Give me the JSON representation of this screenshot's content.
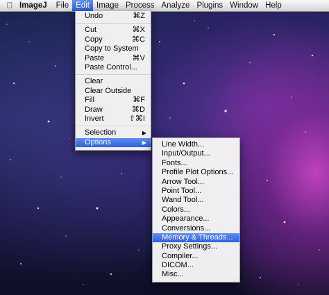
{
  "menubar": {
    "apple_icon": "apple-logo-icon",
    "items": [
      {
        "label": "ImageJ"
      },
      {
        "label": "File"
      },
      {
        "label": "Edit"
      },
      {
        "label": "Image"
      },
      {
        "label": "Process"
      },
      {
        "label": "Analyze"
      },
      {
        "label": "Plugins"
      },
      {
        "label": "Window"
      },
      {
        "label": "Help"
      }
    ],
    "active_menu": "Edit"
  },
  "edit_menu": {
    "undo": {
      "label": "Undo",
      "shortcut": "⌘Z"
    },
    "cut": {
      "label": "Cut",
      "shortcut": "⌘X"
    },
    "copy": {
      "label": "Copy",
      "shortcut": "⌘C"
    },
    "copy_to_system": {
      "label": "Copy to System"
    },
    "paste": {
      "label": "Paste",
      "shortcut": "⌘V"
    },
    "paste_control": {
      "label": "Paste Control..."
    },
    "clear": {
      "label": "Clear"
    },
    "clear_outside": {
      "label": "Clear Outside"
    },
    "fill": {
      "label": "Fill",
      "shortcut": "⌘F"
    },
    "draw": {
      "label": "Draw",
      "shortcut": "⌘D"
    },
    "invert": {
      "label": "Invert",
      "shortcut": "⇧⌘I"
    },
    "selection": {
      "label": "Selection"
    },
    "options": {
      "label": "Options"
    }
  },
  "options_menu": {
    "items": [
      "Line Width...",
      "Input/Output...",
      "Fonts...",
      "Profile Plot Options...",
      "Arrow Tool...",
      "Point Tool...",
      "Wand Tool...",
      "Colors...",
      "Appearance...",
      "Conversions...",
      "Memory & Threads...",
      "Proxy Settings...",
      "Compiler...",
      "DICOM...",
      "Misc..."
    ],
    "highlighted": "Memory & Threads..."
  },
  "colors": {
    "highlight": "#2d62d9",
    "menubar": "#e3e3e3"
  }
}
